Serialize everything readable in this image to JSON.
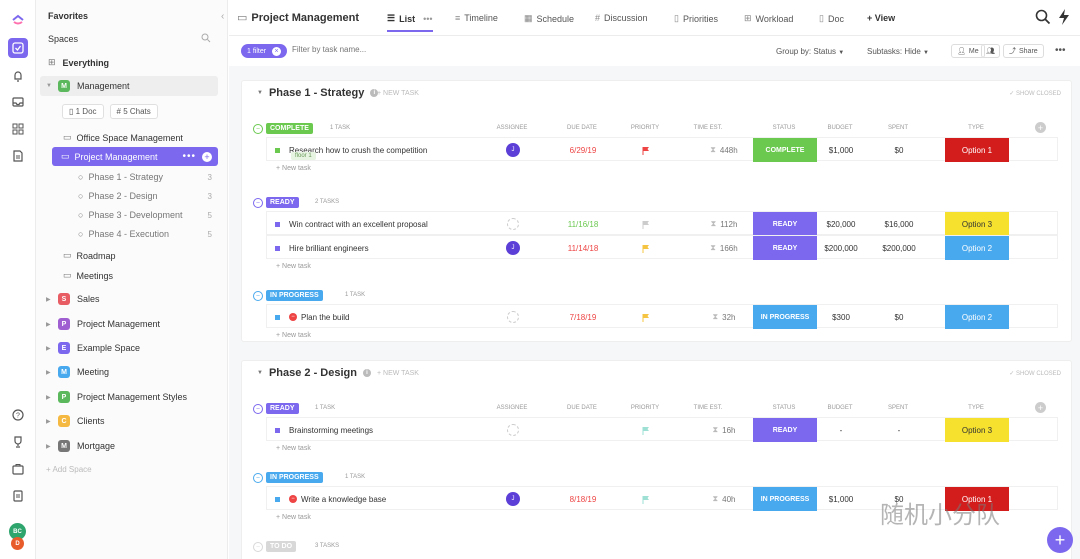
{
  "sidebar": {
    "favorites": "Favorites",
    "spaces": "Spaces",
    "everything": "Everything",
    "management": {
      "letter": "M",
      "label": "Management",
      "color": "#5cb85c"
    },
    "doc_pill": "1 Doc",
    "chats_pill": "5 Chats",
    "folders": [
      {
        "label": "Office Space Management"
      },
      {
        "label": "Project Management",
        "active": true
      }
    ],
    "phases": [
      {
        "label": "Phase 1 - Strategy",
        "count": "3"
      },
      {
        "label": "Phase 2 - Design",
        "count": "3"
      },
      {
        "label": "Phase 3 - Development",
        "count": "5"
      },
      {
        "label": "Phase 4 - Execution",
        "count": "5"
      }
    ],
    "roadmap": "Roadmap",
    "meetings": "Meetings",
    "spaces_list": [
      {
        "letter": "S",
        "label": "Sales",
        "color": "#e85c64"
      },
      {
        "letter": "P",
        "label": "Project Management",
        "color": "#a05fd0"
      },
      {
        "letter": "E",
        "label": "Example Space",
        "color": "#7b68ee"
      },
      {
        "letter": "M",
        "label": "Meeting",
        "color": "#49a9ee"
      },
      {
        "letter": "P",
        "label": "Project Management Styles",
        "color": "#5cb85c"
      },
      {
        "letter": "C",
        "label": "Clients",
        "color": "#f5b942"
      },
      {
        "letter": "M",
        "label": "Mortgage",
        "color": "#777777"
      }
    ],
    "add_space": "+ Add Space"
  },
  "rail": {
    "avatar1": "BC",
    "avatar2": "D"
  },
  "topbar": {
    "title": "Project Management",
    "tabs": [
      "List",
      "Timeline",
      "Schedule",
      "Discussion",
      "Priorities",
      "Workload",
      "Doc"
    ],
    "add_view": "+ View"
  },
  "filterbar": {
    "filter_chip": "1 filter",
    "search_placeholder": "Filter by task name...",
    "group_by": "Group by: Status",
    "subtasks": "Subtasks: Hide",
    "me": "Me",
    "share": "Share"
  },
  "columns": [
    "ASSIGNEE",
    "DUE DATE",
    "PRIORITY",
    "TIME EST.",
    "STATUS",
    "BUDGET",
    "SPENT",
    "TYPE"
  ],
  "phase1": {
    "title": "Phase 1 - Strategy",
    "new_task": "+ NEW TASK",
    "show_closed": "✓ SHOW CLOSED",
    "groups": [
      {
        "badge": "COMPLETE",
        "badge_color": "#6bc950",
        "count": "1 TASK",
        "tasks": [
          {
            "name": "Research how to crush the competition",
            "tag": "floor 1",
            "assignee": "J",
            "due": "6/29/19",
            "due_color": "#e44",
            "priority_color": "#e44",
            "time": "448h",
            "status": "COMPLETE",
            "status_color": "#6bc950",
            "budget": "$1,000",
            "spent": "$0",
            "type": "Option 1",
            "type_color": "#d31c1c",
            "type_text": "#fff",
            "dot": "#6bc950"
          }
        ]
      },
      {
        "badge": "READY",
        "badge_color": "#7b68ee",
        "count": "2 TASKS",
        "tasks": [
          {
            "name": "Win contract with an excellent proposal",
            "assignee": "",
            "due": "11/16/18",
            "due_color": "#6bc950",
            "priority_color": "#ccc",
            "time": "112h",
            "status": "READY",
            "status_color": "#7b68ee",
            "budget": "$20,000",
            "spent": "$16,000",
            "type": "Option 3",
            "type_color": "#f5e12e",
            "type_text": "#333",
            "dot": "#7b68ee"
          },
          {
            "name": "Hire brilliant engineers",
            "assignee": "J",
            "due": "11/14/18",
            "due_color": "#e44",
            "priority_color": "#f5c542",
            "time": "166h",
            "status": "READY",
            "status_color": "#7b68ee",
            "budget": "$200,000",
            "spent": "$200,000",
            "type": "Option 2",
            "type_color": "#49a9ee",
            "type_text": "#fff",
            "dot": "#7b68ee"
          }
        ]
      },
      {
        "badge": "IN PROGRESS",
        "badge_color": "#49a9ee",
        "count": "1 TASK",
        "tasks": [
          {
            "name": "Plan the build",
            "assignee": "",
            "due": "7/18/19",
            "due_color": "#e44",
            "priority_color": "#f5c542",
            "time": "32h",
            "status": "IN PROGRESS",
            "status_color": "#49a9ee",
            "budget": "$300",
            "spent": "$0",
            "type": "Option 2",
            "type_color": "#49a9ee",
            "type_text": "#fff",
            "dot": "#49a9ee",
            "blocked": true
          }
        ]
      }
    ]
  },
  "phase2": {
    "title": "Phase 2 - Design",
    "new_task": "+ NEW TASK",
    "show_closed": "✓ SHOW CLOSED",
    "groups": [
      {
        "badge": "READY",
        "badge_color": "#7b68ee",
        "count": "1 TASK",
        "tasks": [
          {
            "name": "Brainstorming meetings",
            "assignee": "",
            "due": "",
            "due_color": "#999",
            "priority_color": "#9ee0d4",
            "time": "16h",
            "status": "READY",
            "status_color": "#7b68ee",
            "budget": "-",
            "spent": "-",
            "type": "Option 3",
            "type_color": "#f5e12e",
            "type_text": "#333",
            "dot": "#7b68ee"
          }
        ]
      },
      {
        "badge": "IN PROGRESS",
        "badge_color": "#49a9ee",
        "count": "1 TASK",
        "tasks": [
          {
            "name": "Write a knowledge base",
            "assignee": "J",
            "due": "8/18/19",
            "due_color": "#e44",
            "priority_color": "#9ee0d4",
            "time": "40h",
            "status": "IN PROGRESS",
            "status_color": "#49a9ee",
            "budget": "$1,000",
            "spent": "$0",
            "type": "Option 1",
            "type_color": "#d31c1c",
            "type_text": "#fff",
            "dot": "#49a9ee",
            "blocked": true
          }
        ]
      },
      {
        "badge": "TO DO",
        "badge_color": "#d8d8d8",
        "count": "3 TASKS",
        "tasks": []
      }
    ]
  },
  "new_task_link": "+ New task",
  "watermark": "随机小分队"
}
